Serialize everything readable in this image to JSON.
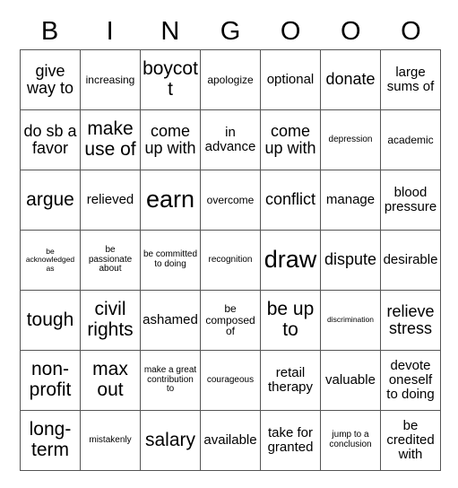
{
  "card": {
    "header": {
      "letters": [
        "B",
        "I",
        "N",
        "G",
        "O",
        "O",
        "O"
      ]
    },
    "rows": [
      [
        {
          "text": "give way to",
          "size": "lg"
        },
        {
          "text": "increasing",
          "size": "sm"
        },
        {
          "text": "boycott",
          "size": "xl"
        },
        {
          "text": "apologize",
          "size": "sm"
        },
        {
          "text": "optional",
          "size": "md"
        },
        {
          "text": "donate",
          "size": "lg"
        },
        {
          "text": "large sums of",
          "size": "md"
        }
      ],
      [
        {
          "text": "do sb a favor",
          "size": "lg"
        },
        {
          "text": "make use of",
          "size": "xl"
        },
        {
          "text": "come up with",
          "size": "lg"
        },
        {
          "text": "in advance",
          "size": "md"
        },
        {
          "text": "come up with",
          "size": "lg"
        },
        {
          "text": "depression",
          "size": "xs"
        },
        {
          "text": "academic",
          "size": "sm"
        }
      ],
      [
        {
          "text": "argue",
          "size": "xl"
        },
        {
          "text": "relieved",
          "size": "md"
        },
        {
          "text": "earn",
          "size": "xxl"
        },
        {
          "text": "overcome",
          "size": "sm"
        },
        {
          "text": "conflict",
          "size": "lg"
        },
        {
          "text": "manage",
          "size": "md"
        },
        {
          "text": "blood pressure",
          "size": "md"
        }
      ],
      [
        {
          "text": "be acknowledged as",
          "size": "xxs"
        },
        {
          "text": "be passionate about",
          "size": "xs"
        },
        {
          "text": "be committed to doing",
          "size": "xs"
        },
        {
          "text": "recognition",
          "size": "xs"
        },
        {
          "text": "draw",
          "size": "xxl"
        },
        {
          "text": "dispute",
          "size": "lg"
        },
        {
          "text": "desirable",
          "size": "md"
        }
      ],
      [
        {
          "text": "tough",
          "size": "xl"
        },
        {
          "text": "civil rights",
          "size": "xl"
        },
        {
          "text": "ashamed",
          "size": "md"
        },
        {
          "text": "be composed of",
          "size": "sm"
        },
        {
          "text": "be up to",
          "size": "xl"
        },
        {
          "text": "discrimination",
          "size": "xxs"
        },
        {
          "text": "relieve stress",
          "size": "lg"
        }
      ],
      [
        {
          "text": "non-profit",
          "size": "xl"
        },
        {
          "text": "max out",
          "size": "xl"
        },
        {
          "text": "make a great contribution to",
          "size": "xs"
        },
        {
          "text": "courageous",
          "size": "xs"
        },
        {
          "text": "retail therapy",
          "size": "md"
        },
        {
          "text": "valuable",
          "size": "md"
        },
        {
          "text": "devote oneself to doing",
          "size": "md"
        }
      ],
      [
        {
          "text": "long-term",
          "size": "xl"
        },
        {
          "text": "mistakenly",
          "size": "xs"
        },
        {
          "text": "salary",
          "size": "xl"
        },
        {
          "text": "available",
          "size": "md"
        },
        {
          "text": "take for granted",
          "size": "md"
        },
        {
          "text": "jump to a conclusion",
          "size": "xs"
        },
        {
          "text": "be credited with",
          "size": "md"
        }
      ]
    ]
  },
  "colors": {
    "grid_line": "#555555",
    "background": "#ffffff",
    "text": "#000000"
  }
}
